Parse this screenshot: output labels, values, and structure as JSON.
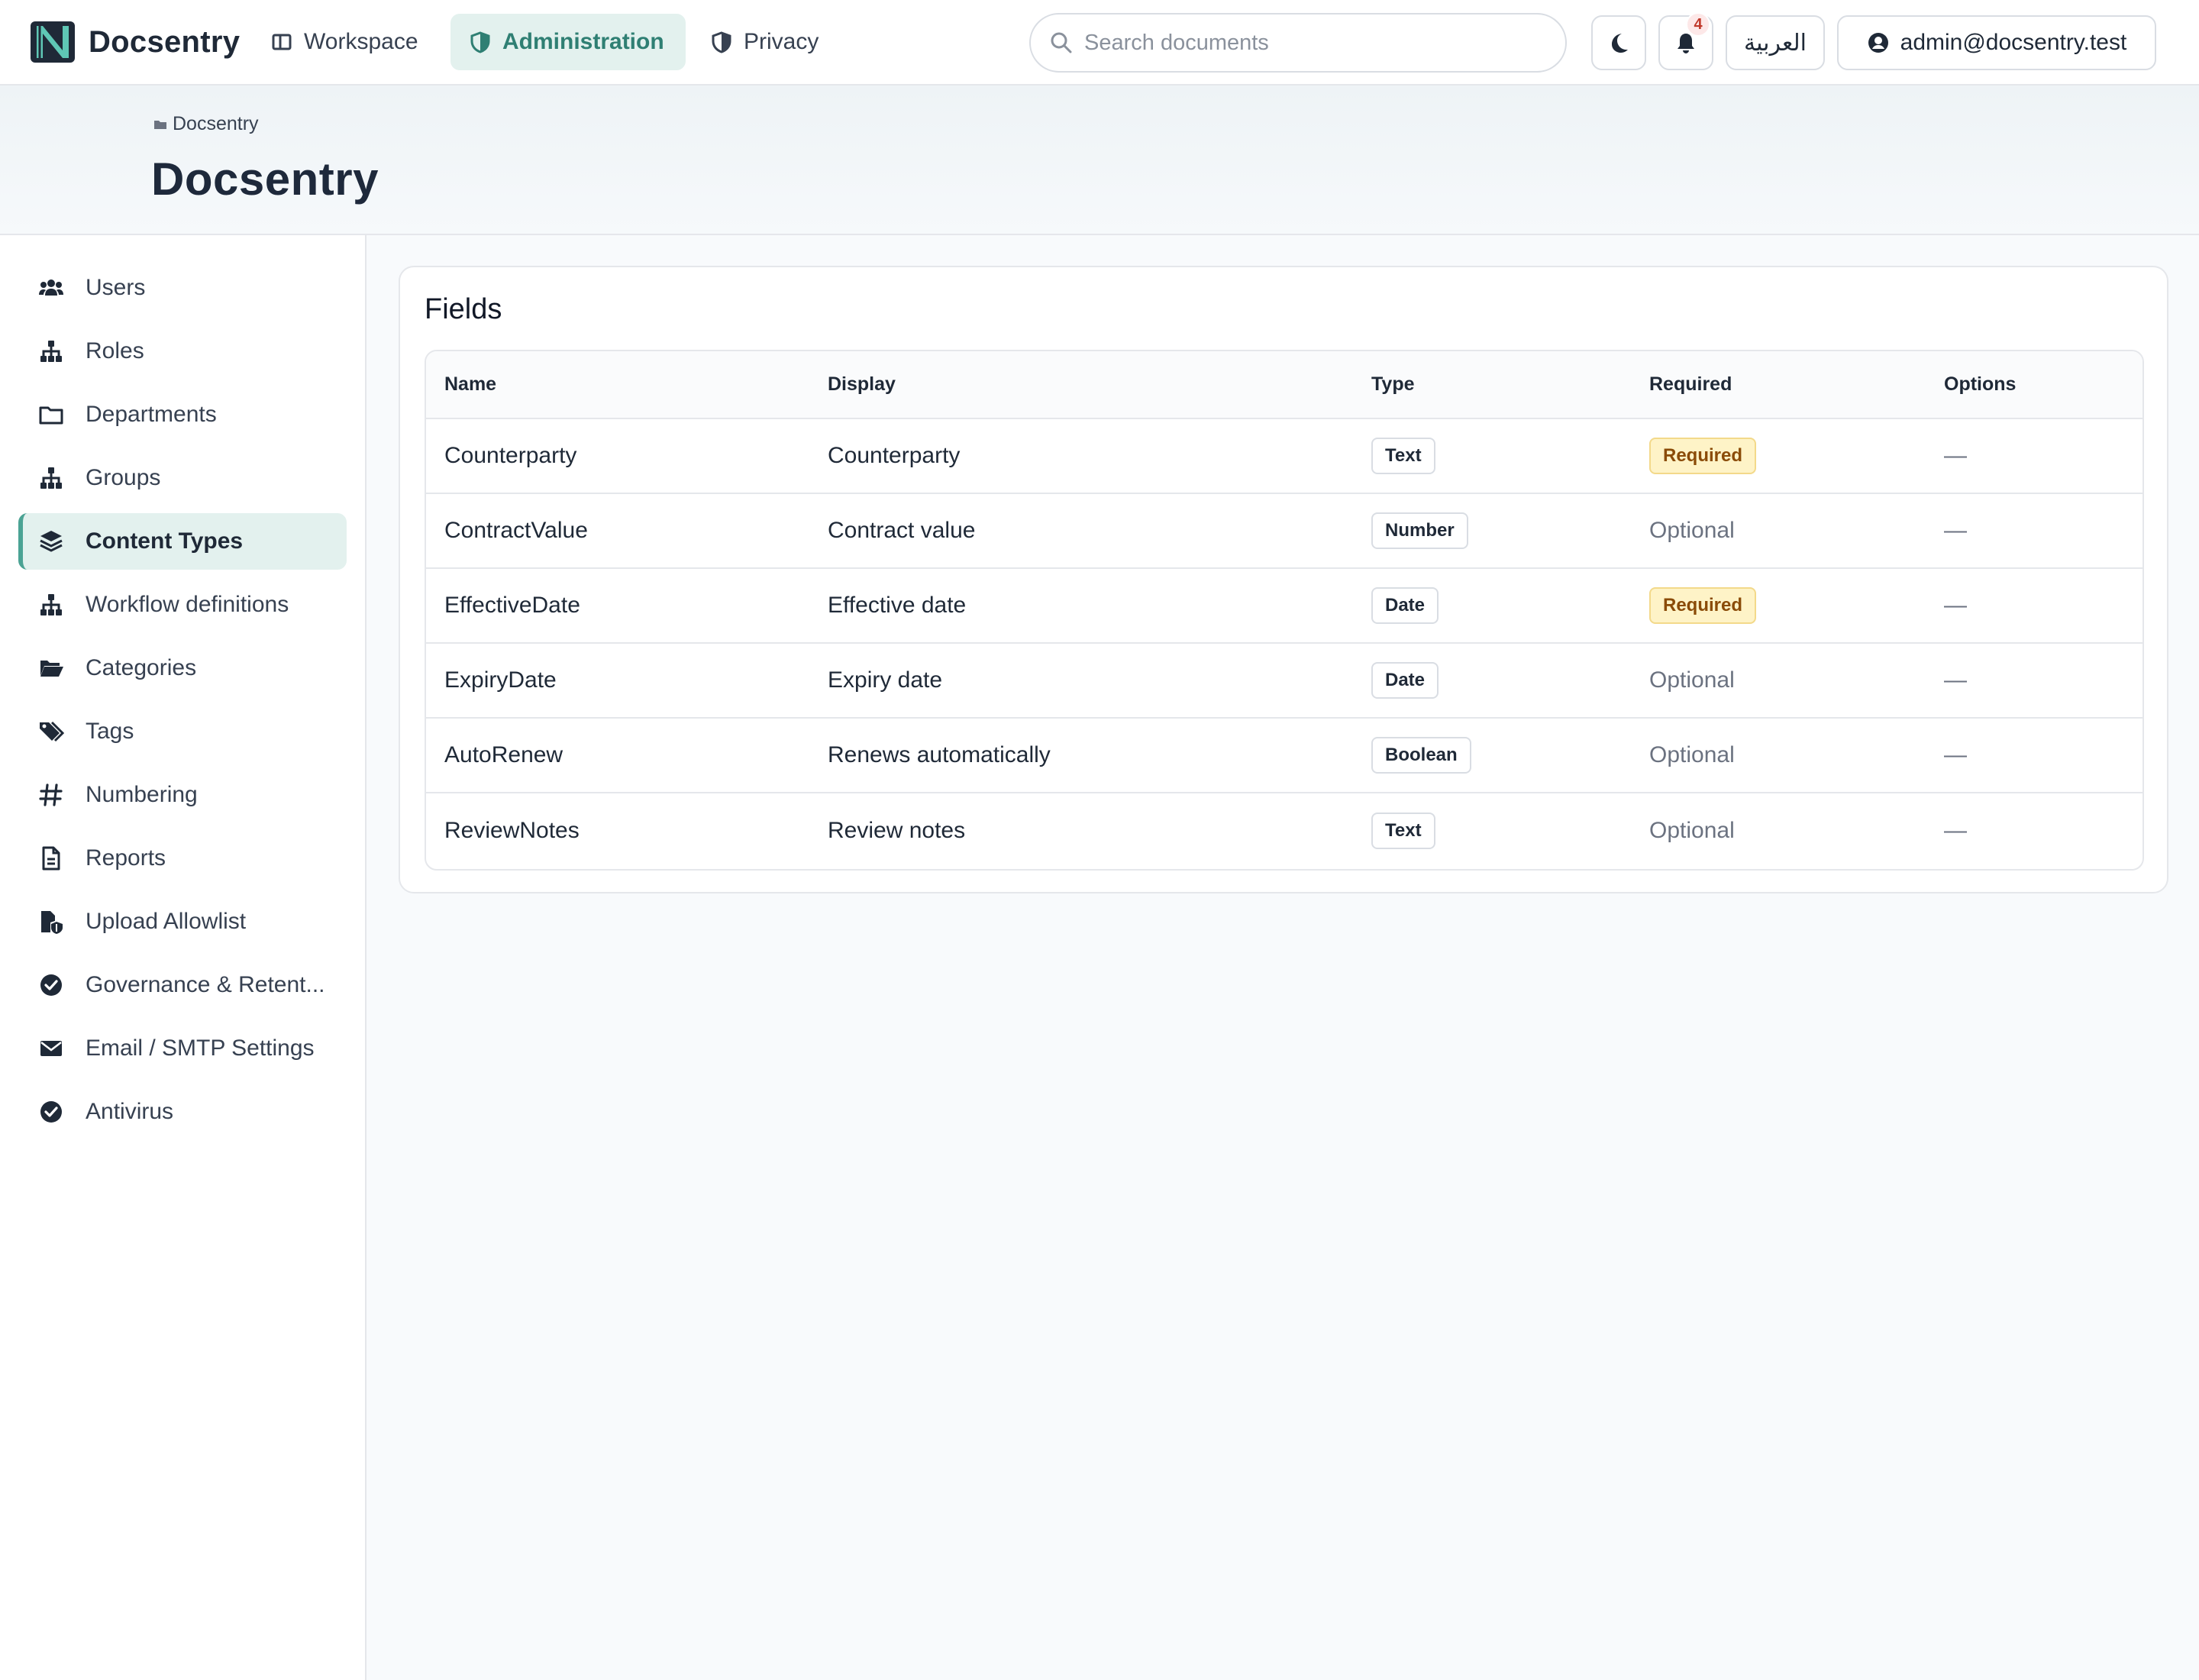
{
  "app": {
    "brand_name": "Docsentry"
  },
  "nav": {
    "workspace": "Workspace",
    "administration": "Administration",
    "privacy": "Privacy"
  },
  "search": {
    "placeholder": "Search documents"
  },
  "toolbar": {
    "notification_count": "4",
    "language_label": "العربية",
    "user_email": "admin@docsentry.test"
  },
  "breadcrumb": {
    "current": "Docsentry"
  },
  "page": {
    "title": "Docsentry"
  },
  "sidebar": {
    "items": [
      {
        "label": "Users",
        "icon": "users-icon"
      },
      {
        "label": "Roles",
        "icon": "sitemap-icon"
      },
      {
        "label": "Departments",
        "icon": "folder-icon"
      },
      {
        "label": "Groups",
        "icon": "sitemap-icon"
      },
      {
        "label": "Content Types",
        "icon": "layers-icon",
        "active": true
      },
      {
        "label": "Workflow definitions",
        "icon": "sitemap-icon"
      },
      {
        "label": "Categories",
        "icon": "folder-open-icon"
      },
      {
        "label": "Tags",
        "icon": "tags-icon"
      },
      {
        "label": "Numbering",
        "icon": "hash-icon"
      },
      {
        "label": "Reports",
        "icon": "file-text-icon"
      },
      {
        "label": "Upload Allowlist",
        "icon": "file-shield-icon"
      },
      {
        "label": "Governance & Retent...",
        "icon": "check-circle-icon"
      },
      {
        "label": "Email / SMTP Settings",
        "icon": "envelope-icon"
      },
      {
        "label": "Antivirus",
        "icon": "check-circle-icon"
      }
    ]
  },
  "fields_card": {
    "title": "Fields",
    "columns": [
      "Name",
      "Display",
      "Type",
      "Required",
      "Options"
    ],
    "rows": [
      {
        "name": "Counterparty",
        "display": "Counterparty",
        "type": "Text",
        "required": "Required",
        "is_required": true,
        "options": "—"
      },
      {
        "name": "ContractValue",
        "display": "Contract value",
        "type": "Number",
        "required": "Optional",
        "is_required": false,
        "options": "—"
      },
      {
        "name": "EffectiveDate",
        "display": "Effective date",
        "type": "Date",
        "required": "Required",
        "is_required": true,
        "options": "—"
      },
      {
        "name": "ExpiryDate",
        "display": "Expiry date",
        "type": "Date",
        "required": "Optional",
        "is_required": false,
        "options": "—"
      },
      {
        "name": "AutoRenew",
        "display": "Renews automatically",
        "type": "Boolean",
        "required": "Optional",
        "is_required": false,
        "options": "—"
      },
      {
        "name": "ReviewNotes",
        "display": "Review notes",
        "type": "Text",
        "required": "Optional",
        "is_required": false,
        "options": "—"
      }
    ]
  },
  "colors": {
    "accent": "#2f7f73",
    "accent_bg": "#e3f1ee",
    "required_bg": "#fef3c7",
    "required_text": "#8a4b08"
  }
}
